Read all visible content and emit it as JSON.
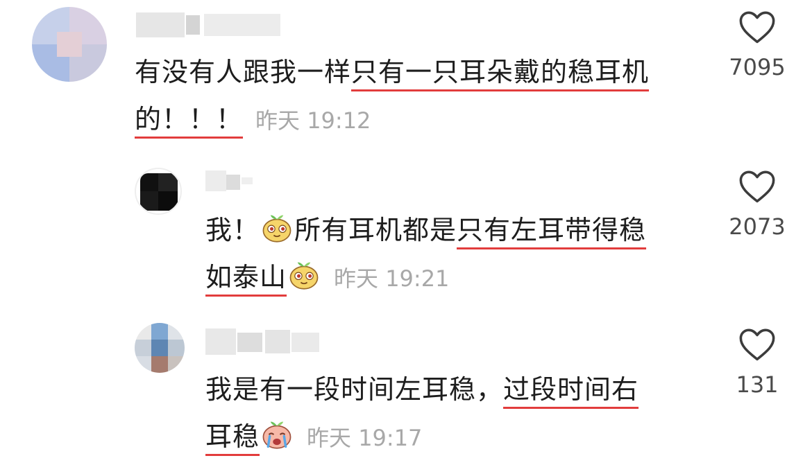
{
  "comments": [
    {
      "text_plain": "有没有人跟我一样",
      "text_underlined_1": "只有一只耳朵戴的稳耳机",
      "text_underlined_2": "的！！！",
      "time": "昨天 19:12",
      "likes": "7095",
      "avatar_colors": [
        "#c8d3ea",
        "#e0c8d6",
        "#a9bde2",
        "#d7dce6"
      ]
    },
    {
      "text_plain": "我！",
      "text_plain_2": "所有耳机都是",
      "text_underlined_1": "只有左耳带得稳",
      "text_underlined_2": "如泰山",
      "time": "昨天 19:21",
      "likes": "2073",
      "avatar_colors": [
        "#1a1a1a",
        "#333333",
        "#555555",
        "#111111"
      ]
    },
    {
      "text_plain": "我是有一段时间左耳稳，",
      "text_underlined_1": "过段时间右",
      "text_underlined_2": "耳稳",
      "time": "昨天 19:17",
      "likes": "131",
      "avatar_colors": [
        "#7fa6cf",
        "#a57c72",
        "#b8c6d6",
        "#e6e6e6"
      ]
    }
  ],
  "icons": {
    "like": "heart-outline-icon",
    "emoji_happy": "sprout-face-emoji-icon",
    "emoji_cry": "crying-face-emoji-icon"
  },
  "colors": {
    "underline": "#e23c3c",
    "timestamp": "#a8a8a8",
    "text": "#1d1d1d"
  }
}
